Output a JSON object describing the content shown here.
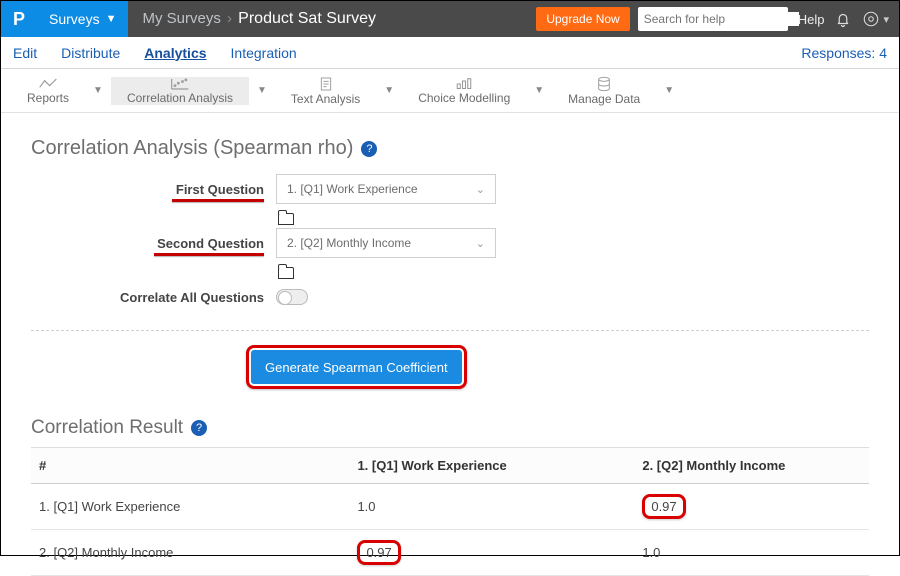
{
  "brand": {
    "letter": "P",
    "surveys_label": "Surveys"
  },
  "breadcrumb": {
    "root": "My Surveys",
    "current": "Product Sat Survey"
  },
  "header": {
    "upgrade": "Upgrade Now",
    "search_placeholder": "Search for help",
    "help": "Help"
  },
  "tabs": {
    "edit": "Edit",
    "distribute": "Distribute",
    "analytics": "Analytics",
    "integration": "Integration",
    "responses_label": "Responses: 4"
  },
  "toolbar": {
    "reports": "Reports",
    "correlation": "Correlation Analysis",
    "text": "Text Analysis",
    "choice": "Choice Modelling",
    "manage": "Manage Data"
  },
  "panel": {
    "title": "Correlation Analysis (Spearman rho)",
    "first_label": "First Question",
    "first_value": "1. [Q1] Work Experience",
    "second_label": "Second Question",
    "second_value": "2. [Q2] Monthly Income",
    "correlate_all_label": "Correlate All Questions",
    "generate_label": "Generate Spearman Coefficient"
  },
  "result": {
    "title": "Correlation Result",
    "hash": "#",
    "col1": "1. [Q1] Work Experience",
    "col2": "2. [Q2] Monthly Income",
    "rows": [
      {
        "label": "1. [Q1] Work Experience",
        "v1": "1.0",
        "v2": "0.97"
      },
      {
        "label": "2. [Q2] Monthly Income",
        "v1": "0.97",
        "v2": "1.0"
      }
    ]
  },
  "colors": {
    "accent": "#1a8be0",
    "upgrade": "#ff6a13",
    "annot": "#d80000"
  }
}
